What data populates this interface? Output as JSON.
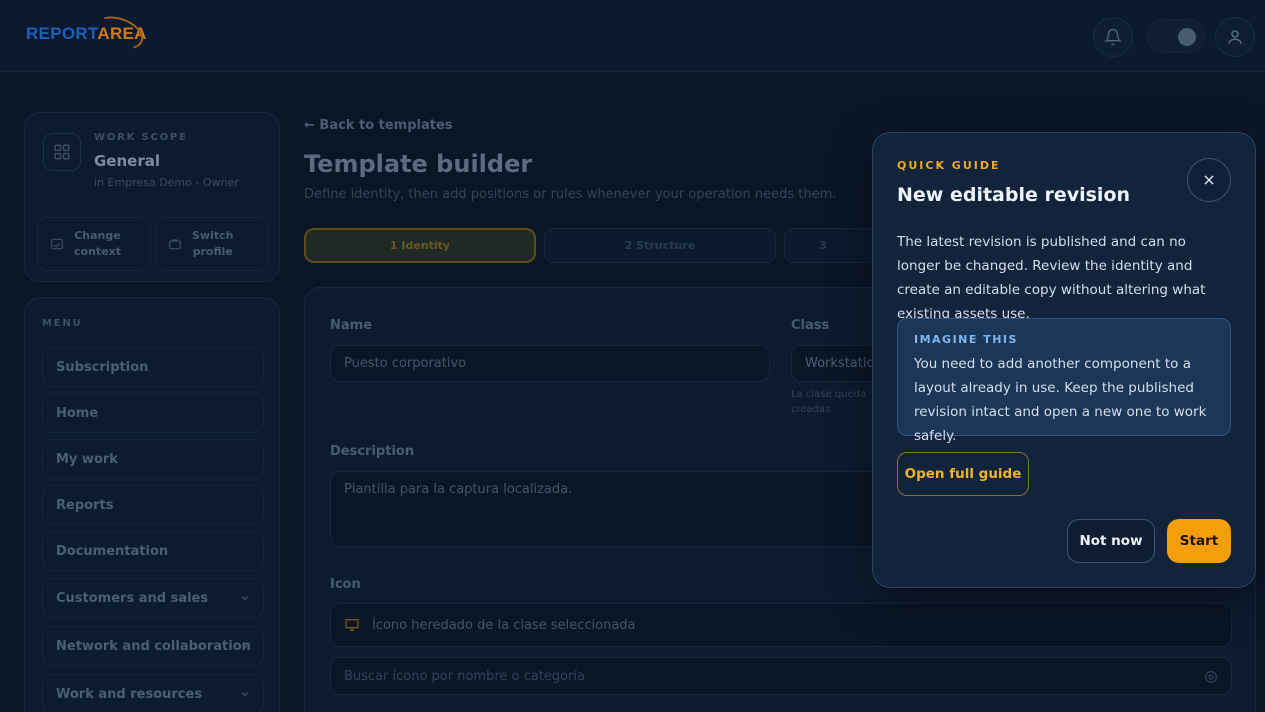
{
  "brand": {
    "part1": "REPORT",
    "part2": "AREA"
  },
  "scope": {
    "label": "WORK SCOPE",
    "title": "General",
    "subtitle": "in Empresa Demo - Owner",
    "change_context": "Change\ncontext",
    "switch_profile": "Switch\nprofile"
  },
  "menu": {
    "label": "MENU",
    "items": [
      {
        "label": "Subscription"
      },
      {
        "label": "Home"
      },
      {
        "label": "My work"
      },
      {
        "label": "Reports"
      },
      {
        "label": "Documentation"
      },
      {
        "label": "Customers and sales"
      },
      {
        "label": "Network and collaboration"
      },
      {
        "label": "Work and resources"
      }
    ]
  },
  "main": {
    "back_link": "← Back to templates",
    "title": "Template builder",
    "subtitle": "Define identity, then add positions or rules whenever your operation needs them.",
    "steps": [
      "1 Identity",
      "2 Structure",
      "3"
    ]
  },
  "form": {
    "name_label": "Name",
    "name_value": "Puesto corporativo",
    "class_label": "Class",
    "class_value": "Workstatio",
    "class_hint_1": "La clase queda",
    "class_hint_2": "creadas.",
    "description_label": "Description",
    "description_value": "Plantilla para la captura localizada.",
    "icon_label": "Icon",
    "icon_value": "Ícono heredado de la clase seleccionada",
    "icon_search_placeholder": "Buscar ícono por nombre o categoría"
  },
  "guide": {
    "eyebrow": "QUICK GUIDE",
    "title": "New editable revision",
    "body": "The latest revision is published and can no longer be changed. Review the identity and create an editable copy without altering what existing assets use.",
    "imagine_label": "IMAGINE THIS",
    "imagine_text": "You need to add another component to a layout already in use. Keep the published revision intact and open a new one to work safely.",
    "open_guide": "Open full guide",
    "not_now": "Not now",
    "start": "Start"
  },
  "colors": {
    "accent": "#f59e0b",
    "brand_blue": "#1f5fb8",
    "brand_orange": "#d07a1c",
    "imagine_bg": "#1c3658"
  }
}
